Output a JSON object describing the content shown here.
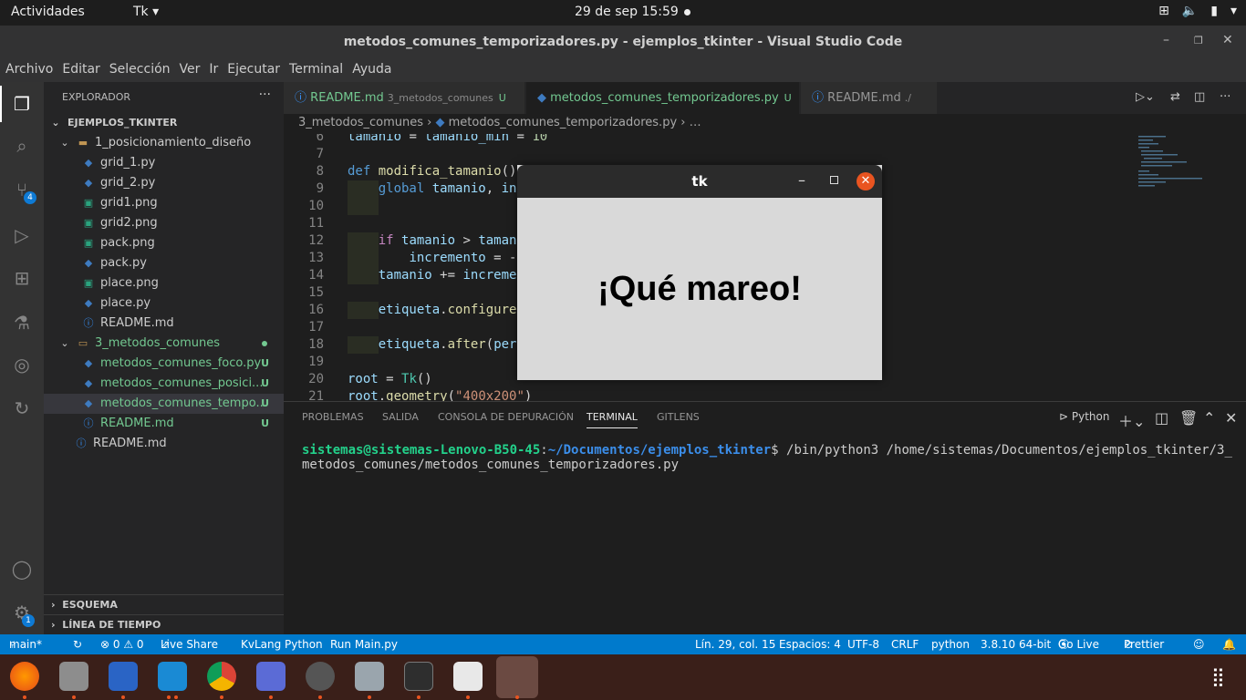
{
  "topbar": {
    "activities": "Actividades",
    "app_menu": "Tk ▾",
    "clock": "29 de sep  15:59"
  },
  "titlebar": {
    "title": "metodos_comunes_temporizadores.py - ejemplos_tkinter - Visual Studio Code"
  },
  "menu": [
    "Archivo",
    "Editar",
    "Selección",
    "Ver",
    "Ir",
    "Ejecutar",
    "Terminal",
    "Ayuda"
  ],
  "activity": {
    "scm_badge": "4",
    "settings_badge": "1"
  },
  "explorer": {
    "header": "EXPLORADOR",
    "root": "EJEMPLOS_TKINTER",
    "items": [
      {
        "label": "1_posicionamiento_diseño",
        "kind": "folder"
      },
      {
        "label": "grid_1.py",
        "kind": "py"
      },
      {
        "label": "grid_2.py",
        "kind": "py"
      },
      {
        "label": "grid1.png",
        "kind": "png"
      },
      {
        "label": "grid2.png",
        "kind": "png"
      },
      {
        "label": "pack.png",
        "kind": "png"
      },
      {
        "label": "pack.py",
        "kind": "py"
      },
      {
        "label": "place.png",
        "kind": "png"
      },
      {
        "label": "place.py",
        "kind": "py"
      },
      {
        "label": "README.md",
        "kind": "info"
      },
      {
        "label": "3_metodos_comunes",
        "kind": "folder"
      },
      {
        "label": "metodos_comunes_foco.py",
        "kind": "py",
        "status": "U"
      },
      {
        "label": "metodos_comunes_posici...",
        "kind": "py",
        "status": "U"
      },
      {
        "label": "metodos_comunes_tempo...",
        "kind": "py",
        "status": "U"
      },
      {
        "label": "README.md",
        "kind": "info",
        "status": "U"
      },
      {
        "label": "README.md",
        "kind": "info"
      }
    ],
    "outline": "ESQUEMA",
    "timeline": "LÍNEA DE TIEMPO"
  },
  "tabs": [
    {
      "label": "README.md",
      "desc": "3_metodos_comunes",
      "status": "U"
    },
    {
      "label": "metodos_comunes_temporizadores.py",
      "status": "U"
    },
    {
      "label": "README.md",
      "desc": "./"
    }
  ],
  "breadcrumb": {
    "folder": "3_metodos_comunes",
    "file": "metodos_comunes_temporizadores.py",
    "tail": "…"
  },
  "code": {
    "line_numbers": [
      "6",
      "7",
      "8",
      "9",
      "10",
      "11",
      "12",
      "13",
      "14",
      "15",
      "16",
      "17",
      "18",
      "19",
      "20",
      "21"
    ]
  },
  "tk_window": {
    "title": "tk",
    "label": "¡Qué mareo!"
  },
  "panel": {
    "tabs": [
      "PROBLEMAS",
      "SALIDA",
      "CONSOLA DE DEPURACIÓN",
      "TERMINAL",
      "GITLENS"
    ],
    "profile": "Python",
    "prompt_user": "sistemas@sistemas-Lenovo-B50-45",
    "prompt_path": "~/Documentos/ejemplos_tkinter",
    "command": "$ /bin/python3 /home/sistemas/Documentos/ejemplos_tkinter/3_metodos_comunes/metodos_comunes_temporizadores.py"
  },
  "status": {
    "branch": "main*",
    "problems": "⊗ 0 ⚠ 0",
    "liveshare": "Live Share",
    "kvlang": "KvLang Python",
    "runmain": "Run Main.py",
    "position": "Lín. 29, col. 15",
    "spaces": "Espacios: 4",
    "encoding": "UTF-8",
    "eol": "CRLF",
    "language": "python",
    "interpreter": "3.8.10 64-bit",
    "golive": "Go Live",
    "prettier": "Prettier"
  }
}
